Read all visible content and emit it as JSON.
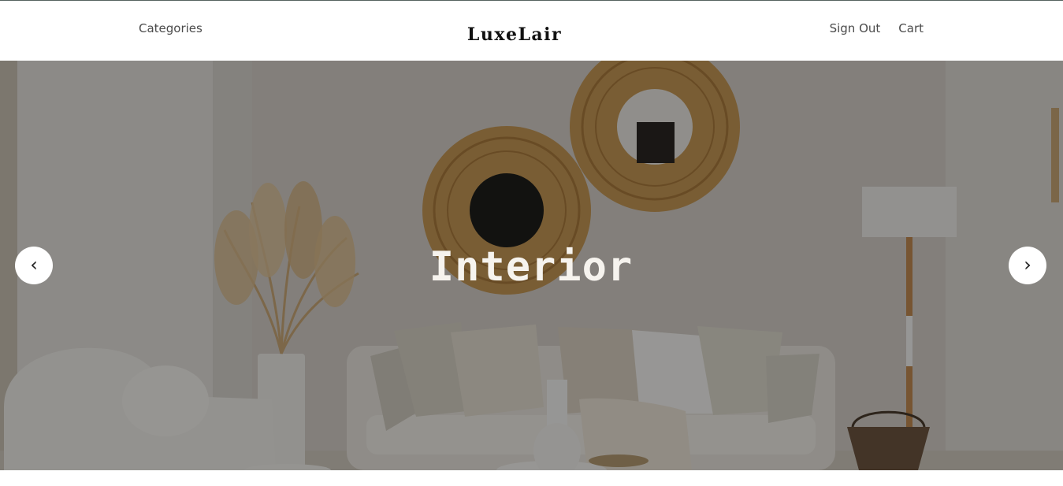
{
  "header": {
    "categories_label": "Categories",
    "brand": "LuxeLair",
    "sign_out_label": "Sign Out",
    "cart_label": "Cart"
  },
  "hero": {
    "title": "Interior",
    "prev_arrow": "‹",
    "next_arrow": "›"
  },
  "colors": {
    "overlay": "#000000",
    "rattan": "#b88a48",
    "wall": "#d4cfc8",
    "sofa": "#e6e2da"
  }
}
